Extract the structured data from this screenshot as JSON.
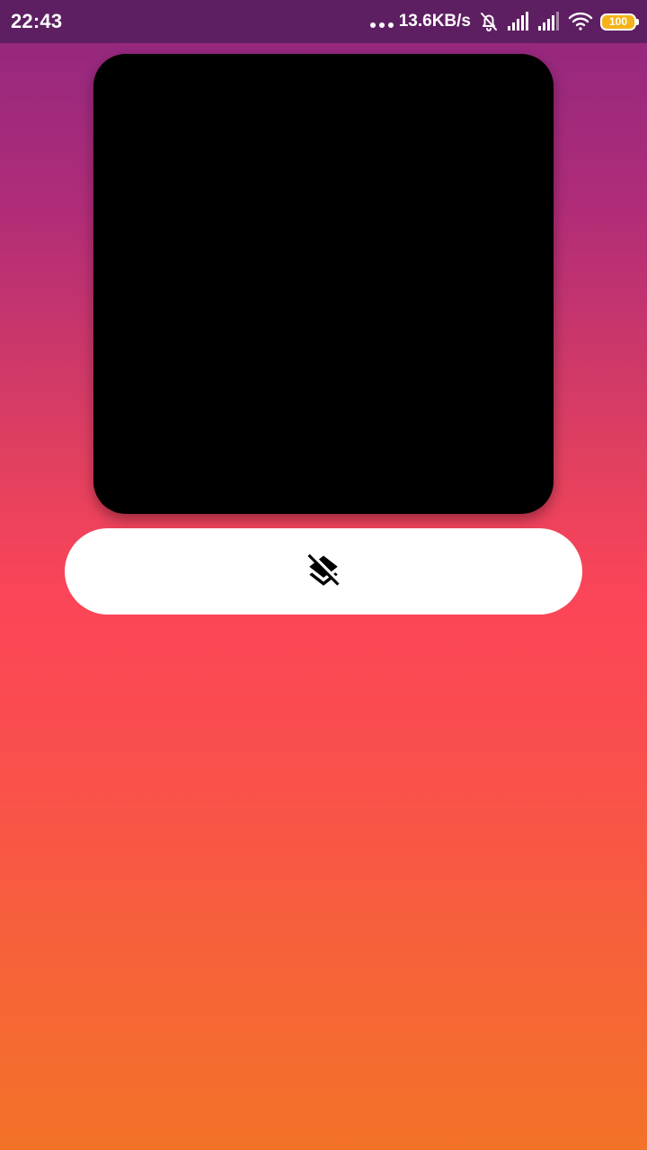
{
  "status_bar": {
    "time": "22:43",
    "net_speed": "13.6KB/s",
    "battery": "100",
    "icons": [
      "more-dots-icon",
      "bell-off-icon",
      "signal-icon",
      "signal-icon",
      "wifi-icon",
      "battery-icon"
    ]
  },
  "preview": {
    "color": "#000000"
  },
  "action_button": {
    "icon": "layers-clear-icon",
    "background": "#ffffff"
  },
  "background": {
    "gradient": [
      "#8f2780",
      "#fc4558",
      "#f37228"
    ]
  }
}
